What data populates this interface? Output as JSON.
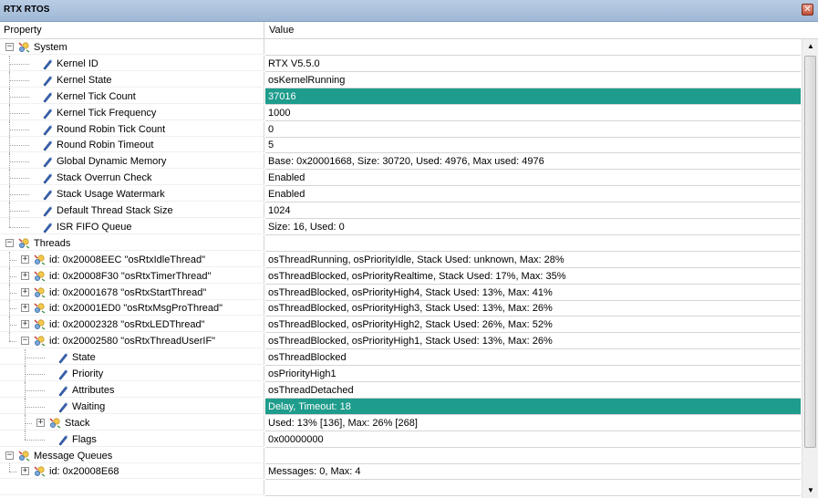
{
  "window": {
    "title": "RTX RTOS"
  },
  "columns": {
    "property": "Property",
    "value": "Value"
  },
  "colors": {
    "highlight": "#1e9c8c"
  },
  "rows": [
    {
      "label": "System",
      "value": "",
      "level": 0,
      "type": "group",
      "expander": "minus"
    },
    {
      "label": "Kernel ID",
      "value": "RTX V5.5.0",
      "level": 1,
      "type": "leaf"
    },
    {
      "label": "Kernel State",
      "value": "osKernelRunning",
      "level": 1,
      "type": "leaf"
    },
    {
      "label": "Kernel Tick Count",
      "value": "37016",
      "level": 1,
      "type": "leaf",
      "highlight": true
    },
    {
      "label": "Kernel Tick Frequency",
      "value": "1000",
      "level": 1,
      "type": "leaf"
    },
    {
      "label": "Round Robin Tick Count",
      "value": "0",
      "level": 1,
      "type": "leaf"
    },
    {
      "label": "Round Robin Timeout",
      "value": "5",
      "level": 1,
      "type": "leaf"
    },
    {
      "label": "Global Dynamic Memory",
      "value": "Base: 0x20001668, Size: 30720, Used: 4976, Max used: 4976",
      "level": 1,
      "type": "leaf"
    },
    {
      "label": "Stack Overrun Check",
      "value": "Enabled",
      "level": 1,
      "type": "leaf"
    },
    {
      "label": "Stack Usage Watermark",
      "value": "Enabled",
      "level": 1,
      "type": "leaf"
    },
    {
      "label": "Default Thread Stack Size",
      "value": "1024",
      "level": 1,
      "type": "leaf"
    },
    {
      "label": "ISR FIFO Queue",
      "value": "Size: 16, Used: 0",
      "level": 1,
      "type": "leaf",
      "last": true
    },
    {
      "label": "Threads",
      "value": "",
      "level": 0,
      "type": "group",
      "expander": "minus"
    },
    {
      "label": "id: 0x20008EEC \"osRtxIdleThread\"",
      "value": "osThreadRunning, osPriorityIdle, Stack Used: unknown, Max: 28%",
      "level": 1,
      "type": "group",
      "expander": "plus"
    },
    {
      "label": "id: 0x20008F30 \"osRtxTimerThread\"",
      "value": "osThreadBlocked, osPriorityRealtime, Stack Used: 17%, Max: 35%",
      "level": 1,
      "type": "group",
      "expander": "plus"
    },
    {
      "label": "id: 0x20001678 \"osRtxStartThread\"",
      "value": "osThreadBlocked, osPriorityHigh4, Stack Used: 13%, Max: 41%",
      "level": 1,
      "type": "group",
      "expander": "plus"
    },
    {
      "label": "id: 0x20001ED0 \"osRtxMsgProThread\"",
      "value": "osThreadBlocked, osPriorityHigh3, Stack Used: 13%, Max: 26%",
      "level": 1,
      "type": "group",
      "expander": "plus"
    },
    {
      "label": "id: 0x20002328 \"osRtxLEDThread\"",
      "value": "osThreadBlocked, osPriorityHigh2, Stack Used: 26%, Max: 52%",
      "level": 1,
      "type": "group",
      "expander": "plus"
    },
    {
      "label": "id: 0x20002580 \"osRtxThreadUserIF\"",
      "value": "osThreadBlocked, osPriorityHigh1, Stack Used: 13%, Max: 26%",
      "level": 1,
      "type": "group",
      "expander": "minus",
      "last": true
    },
    {
      "label": "State",
      "value": "osThreadBlocked",
      "level": 2,
      "type": "leaf"
    },
    {
      "label": "Priority",
      "value": "osPriorityHigh1",
      "level": 2,
      "type": "leaf"
    },
    {
      "label": "Attributes",
      "value": "osThreadDetached",
      "level": 2,
      "type": "leaf"
    },
    {
      "label": "Waiting",
      "value": "Delay, Timeout: 18",
      "level": 2,
      "type": "leaf",
      "highlight": true
    },
    {
      "label": "Stack",
      "value": "Used: 13% [136], Max: 26% [268]",
      "level": 2,
      "type": "group",
      "expander": "plus"
    },
    {
      "label": "Flags",
      "value": "0x00000000",
      "level": 2,
      "type": "leaf",
      "last": true
    },
    {
      "label": "Message Queues",
      "value": "",
      "level": 0,
      "type": "group",
      "expander": "minus"
    },
    {
      "label": "id: 0x20008E68",
      "value": "Messages: 0, Max: 4",
      "level": 1,
      "type": "group",
      "expander": "plus",
      "last": true
    },
    {
      "label": "",
      "value": "",
      "level": 0,
      "type": "empty"
    }
  ]
}
